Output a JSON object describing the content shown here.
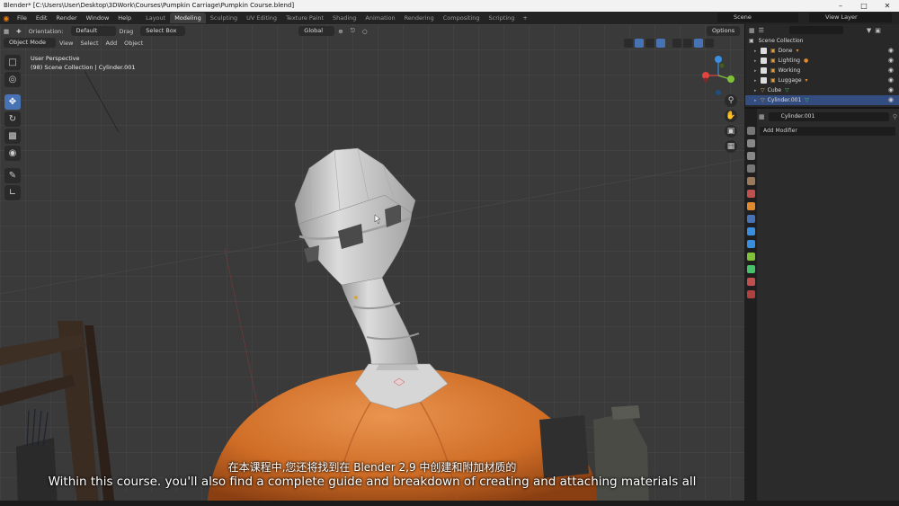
{
  "window": {
    "title": "Blender* [C:\\Users\\User\\Desktop\\3DWork\\Courses\\Pumpkin Carriage\\Pumpkin Course.blend]"
  },
  "topbar": {
    "menus": [
      "File",
      "Edit",
      "Render",
      "Window",
      "Help"
    ],
    "workspaces": [
      "Layout",
      "Modeling",
      "Sculpting",
      "UV Editing",
      "Texture Paint",
      "Shading",
      "Animation",
      "Rendering",
      "Compositing",
      "Scripting"
    ],
    "active_workspace": "Modeling",
    "scene": "Scene",
    "view_layer": "View Layer"
  },
  "viewport_header": {
    "orientation_label": "Orientation:",
    "orientation_value": "Default",
    "drag_label": "Drag",
    "drag_value": "Select Box",
    "transform_orientation": "Global",
    "mode": "Object Mode",
    "menus": [
      "View",
      "Select",
      "Add",
      "Object"
    ],
    "options": "Options"
  },
  "viewport": {
    "view_name": "User Perspective",
    "collection_info": "(98) Scene Collection | Cylinder.001"
  },
  "outliner": {
    "root": "Scene Collection",
    "items": [
      {
        "name": "Done",
        "type": "collection",
        "selected": false
      },
      {
        "name": "Lighting",
        "type": "collection",
        "selected": false
      },
      {
        "name": "Working",
        "type": "collection",
        "selected": false
      },
      {
        "name": "Luggage",
        "type": "collection",
        "selected": false
      },
      {
        "name": "Cube",
        "type": "object",
        "selected": false
      },
      {
        "name": "Cylinder.001",
        "type": "object",
        "selected": true
      }
    ]
  },
  "properties": {
    "object_name": "Cylinder.001",
    "add_modifier": "Add Modifier"
  },
  "subtitles": {
    "line1": "在本课程中,您还将找到在 Blender 2,9 中创建和附加材质的",
    "line2": "Within this course. you'll also find a complete guide and breakdown of creating and attaching materials all"
  },
  "colors": {
    "accent": "#4772b3",
    "pumpkin": "#d9792f",
    "tower": "#c9c9c9",
    "x_axis": "#e0453f",
    "y_axis": "#7fc23a",
    "z_axis": "#3a8ee0"
  }
}
